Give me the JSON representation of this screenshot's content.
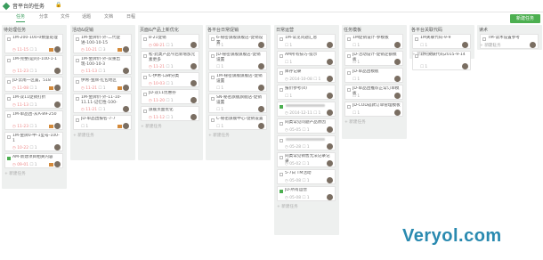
{
  "project": {
    "title": "音平台的任务"
  },
  "tabs": [
    "任务",
    "分享",
    "文件",
    "话题",
    "文档",
    "日程"
  ],
  "new_task_button": "新建任务",
  "add_task_label": "新建任务",
  "columns": [
    {
      "title": "待处理任务",
      "cards": [
        {
          "title": "1M-200-100-0数量处理",
          "date": "11-15",
          "count": "1",
          "done": false
        },
        {
          "title": "1M-完整(是的)-100-1-1",
          "date": "11-23",
          "count": "1",
          "done": false
        },
        {
          "title": "JD-云南一区置，518",
          "date": "11-08",
          "count": "1",
          "done": false
        },
        {
          "title": "1M-双11促销打折",
          "date": "11-13",
          "count": "1",
          "done": false
        },
        {
          "title": "1M-单品团-从A-89-250",
          "date": "11-23",
          "count": "1",
          "done": false
        },
        {
          "title": "1M-金牌0-中-1型号-100-1",
          "date": "10-22",
          "count": "1",
          "done": false
        },
        {
          "title": "AM-新建项目相关内容",
          "date": "09-01",
          "count": "1",
          "done": true
        }
      ]
    },
    {
      "title": "活动&促销",
      "cards": [
        {
          "title": "1M-金牌价-外-二代促进-100-10-15",
          "date": "10-21",
          "count": "3",
          "done": false
        },
        {
          "title": "1M-金牌价-外-双重出现-100-10-3",
          "date": "11-13",
          "count": "1",
          "done": false
        },
        {
          "title": "伊希-金牌-红包地区",
          "date": "11-21",
          "count": "1",
          "done": false
        },
        {
          "title": "1M-金牌价-外-11-10-11.11-记忆性-100-",
          "date": "11-21",
          "count": "1",
          "done": false
        },
        {
          "title": "JD-单品团报名-7-7",
          "date": "",
          "count": "1",
          "done": false
        }
      ]
    },
    {
      "title": "页面&产品上新优化",
      "cards": [
        {
          "title": "8-21促销",
          "date": "08-21",
          "count": "1",
          "done": false
        },
        {
          "title": "松-此类产品今后新增加元素更多",
          "date": "11-21",
          "count": "1",
          "done": false
        },
        {
          "title": "C-伊希-口碑分类",
          "date": "10-03",
          "count": "1",
          "done": false
        },
        {
          "title": "JD-双11优惠券",
          "date": "11-20",
          "count": "1",
          "done": false
        },
        {
          "title": "旗舰页面优化",
          "date": "11-12",
          "count": "1",
          "done": false
        }
      ]
    },
    {
      "title": "各平台日常促销",
      "cards": [
        {
          "title": "6-秘密旗舰旗舰店-促销设置",
          "date": "",
          "count": "1",
          "done": false
        },
        {
          "title": "JD-秘密旗舰旗舰店-促销设置",
          "date": "",
          "count": "1",
          "done": false
        },
        {
          "title": "1M-秘密旗舰旗舰店-促销设置",
          "date": "",
          "count": "1",
          "done": false
        },
        {
          "title": "SN-秘密旗舰旗舰店-促销设置",
          "date": "",
          "count": "1",
          "done": false
        },
        {
          "title": "C-秘密旗舰中心-促销设置",
          "date": "",
          "count": "1",
          "done": false
        }
      ]
    },
    {
      "title": "日常运营",
      "cards": [
        {
          "title": "1M-常见问题汇总",
          "date": "",
          "count": "1",
          "done": false
        },
        {
          "title": "AM所有技巧-提示",
          "date": "",
          "count": "1",
          "done": false
        },
        {
          "title": "库存记录",
          "date": "2014-10-08",
          "count": "1",
          "done": false
        },
        {
          "title": "报价参考(4)",
          "date": "",
          "count": "1",
          "done": false
        },
        {
          "title": "",
          "date": "2014-12-11",
          "count": "1",
          "done": true
        },
        {
          "title": "同类常见问题产品原因",
          "date": "05-05",
          "count": "1",
          "done": false
        },
        {
          "title": "",
          "date": "05-28",
          "count": "1",
          "done": false
        },
        {
          "title": "同类常见销售无法记录记录",
          "date": "05-02",
          "count": "1",
          "done": false
        },
        {
          "title": "5-7日 TM活动",
          "date": "05-08",
          "count": "1",
          "done": false
        },
        {
          "title": "JD-所有运营",
          "date": "05-08",
          "count": "1",
          "done": true
        }
      ]
    },
    {
      "title": "任务模板",
      "cards": [
        {
          "title": "1M促销设计-参模板",
          "date": "",
          "count": "1",
          "done": false
        },
        {
          "title": "JD-活动设计-促销定额模板",
          "date": "",
          "count": "1",
          "done": false
        },
        {
          "title": "JD-单品团模板",
          "date": "",
          "count": "1",
          "done": false
        },
        {
          "title": "JD-单品团推荐正常订单模板",
          "date": "",
          "count": "1",
          "done": false
        },
        {
          "title": "JD-COD返款订单管理模板",
          "date": "",
          "count": "1",
          "done": false
        }
      ]
    },
    {
      "title": "各平台关联代码",
      "cards": [
        {
          "title": "1M关联代码-9-9",
          "date": "",
          "count": "1",
          "done": false
        },
        {
          "title": "1M-关联代码2015-9-14",
          "date": "",
          "count": "1",
          "done": false
        }
      ]
    },
    {
      "title": "读术",
      "cards": [
        {
          "title": "TM-读术设置参考",
          "date": "",
          "count": "1",
          "done": false
        }
      ]
    }
  ],
  "watermark": "Veryol.com"
}
